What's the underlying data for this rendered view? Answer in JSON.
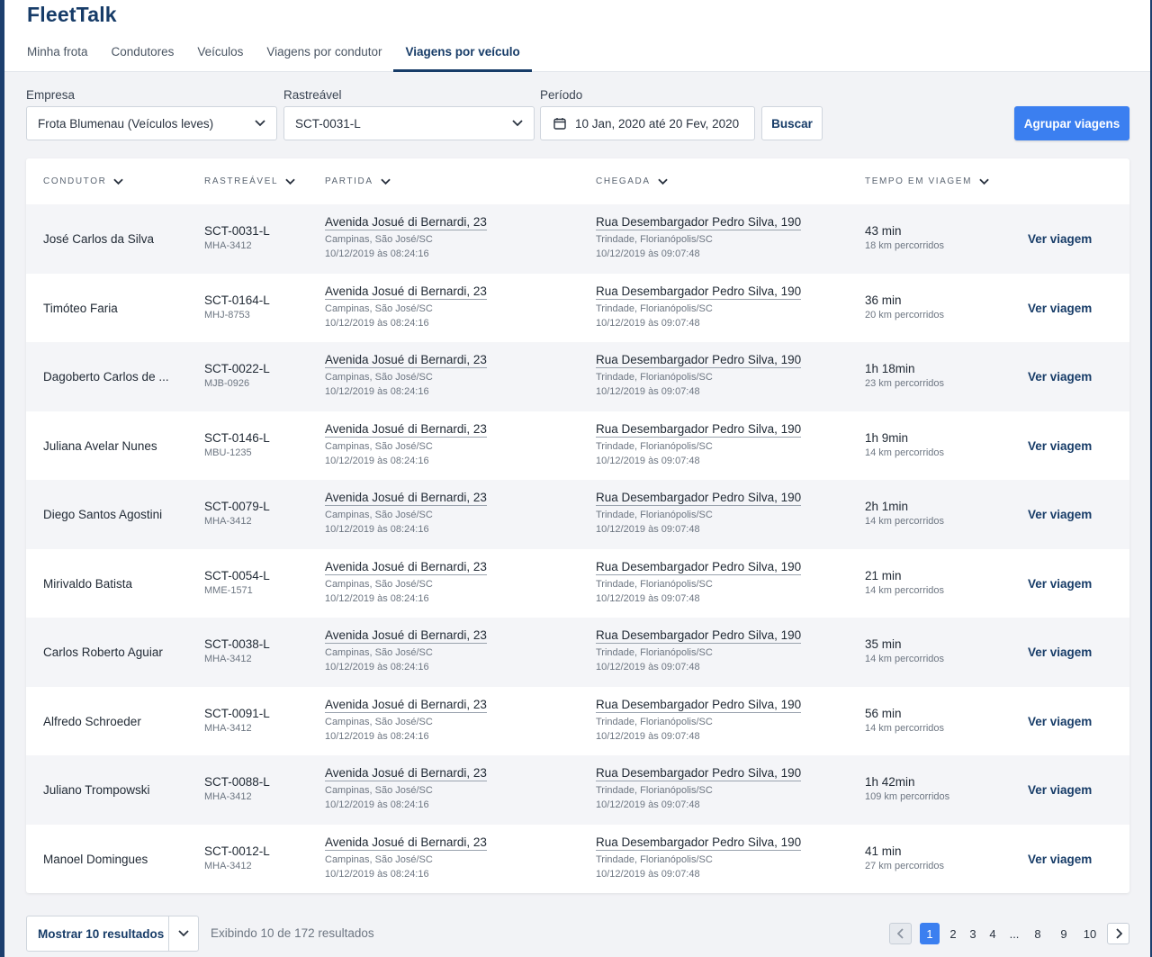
{
  "app": {
    "name": "FleetTalk"
  },
  "tabs": [
    {
      "label": "Minha frota"
    },
    {
      "label": "Condutores"
    },
    {
      "label": "Veículos"
    },
    {
      "label": "Viagens por condutor"
    },
    {
      "label": "Viagens por veículo",
      "active": true
    }
  ],
  "filters": {
    "company_label": "Empresa",
    "company_value": "Frota Blumenau (Veículos leves)",
    "tracker_label": "Rastreável",
    "tracker_value": "SCT-0031-L",
    "period_label": "Período",
    "period_value": "10 Jan, 2020 até 20 Fev, 2020",
    "search_button": "Buscar",
    "group_button": "Agrupar viagens"
  },
  "table": {
    "headers": {
      "driver": "CONDUTOR",
      "tracker": "RASTREÁVEL",
      "departure": "PARTIDA",
      "arrival": "CHEGADA",
      "duration": "TEMPO EM VIAGEM"
    },
    "action_label": "Ver viagem",
    "rows": [
      {
        "driver": "José Carlos da Silva",
        "tracker": "SCT-0031-L",
        "plate": "MHA-3412",
        "dep_addr": "Avenida Josué di Bernardi, 23",
        "dep_city": "Campinas, São José/SC",
        "dep_dt": "10/12/2019 às 08:24:16",
        "arr_addr": "Rua Desembargador Pedro Silva, 190",
        "arr_city": "Trindade, Florianópolis/SC",
        "arr_dt": "10/12/2019 às 09:07:48",
        "time": "43 min",
        "dist": "18 km percorridos"
      },
      {
        "driver": "Timóteo Faria",
        "tracker": "SCT-0164-L",
        "plate": "MHJ-8753",
        "dep_addr": "Avenida Josué di Bernardi, 23",
        "dep_city": "Campinas, São José/SC",
        "dep_dt": "10/12/2019 às 08:24:16",
        "arr_addr": "Rua Desembargador Pedro Silva, 190",
        "arr_city": "Trindade, Florianópolis/SC",
        "arr_dt": "10/12/2019 às 09:07:48",
        "time": "36 min",
        "dist": "20 km percorridos"
      },
      {
        "driver": "Dagoberto Carlos de ...",
        "tracker": "SCT-0022-L",
        "plate": "MJB-0926",
        "dep_addr": "Avenida Josué di Bernardi, 23",
        "dep_city": "Campinas, São José/SC",
        "dep_dt": "10/12/2019 às 08:24:16",
        "arr_addr": "Rua Desembargador Pedro Silva, 190",
        "arr_city": "Trindade, Florianópolis/SC",
        "arr_dt": "10/12/2019 às 09:07:48",
        "time": "1h 18min",
        "dist": "23 km percorridos"
      },
      {
        "driver": "Juliana Avelar Nunes",
        "tracker": "SCT-0146-L",
        "plate": "MBU-1235",
        "dep_addr": "Avenida Josué di Bernardi, 23",
        "dep_city": "Campinas, São José/SC",
        "dep_dt": "10/12/2019 às 08:24:16",
        "arr_addr": "Rua Desembargador Pedro Silva, 190",
        "arr_city": "Trindade, Florianópolis/SC",
        "arr_dt": "10/12/2019 às 09:07:48",
        "time": "1h 9min",
        "dist": "14 km percorridos"
      },
      {
        "driver": "Diego Santos Agostini",
        "tracker": "SCT-0079-L",
        "plate": "MHA-3412",
        "dep_addr": "Avenida Josué di Bernardi, 23",
        "dep_city": "Campinas, São José/SC",
        "dep_dt": "10/12/2019 às 08:24:16",
        "arr_addr": "Rua Desembargador Pedro Silva, 190",
        "arr_city": "Trindade, Florianópolis/SC",
        "arr_dt": "10/12/2019 às 09:07:48",
        "time": "2h 1min",
        "dist": "14 km percorridos"
      },
      {
        "driver": "Mirivaldo Batista",
        "tracker": "SCT-0054-L",
        "plate": "MME-1571",
        "dep_addr": "Avenida Josué di Bernardi, 23",
        "dep_city": "Campinas, São José/SC",
        "dep_dt": "10/12/2019 às 08:24:16",
        "arr_addr": "Rua Desembargador Pedro Silva, 190",
        "arr_city": "Trindade, Florianópolis/SC",
        "arr_dt": "10/12/2019 às 09:07:48",
        "time": "21 min",
        "dist": "14 km percorridos"
      },
      {
        "driver": "Carlos Roberto Aguiar",
        "tracker": "SCT-0038-L",
        "plate": "MHA-3412",
        "dep_addr": "Avenida Josué di Bernardi, 23",
        "dep_city": "Campinas, São José/SC",
        "dep_dt": "10/12/2019 às 08:24:16",
        "arr_addr": "Rua Desembargador Pedro Silva, 190",
        "arr_city": "Trindade, Florianópolis/SC",
        "arr_dt": "10/12/2019 às 09:07:48",
        "time": "35 min",
        "dist": "14 km percorridos"
      },
      {
        "driver": "Alfredo Schroeder",
        "tracker": "SCT-0091-L",
        "plate": "MHA-3412",
        "dep_addr": "Avenida Josué di Bernardi, 23",
        "dep_city": "Campinas, São José/SC",
        "dep_dt": "10/12/2019 às 08:24:16",
        "arr_addr": "Rua Desembargador Pedro Silva, 190",
        "arr_city": "Trindade, Florianópolis/SC",
        "arr_dt": "10/12/2019 às 09:07:48",
        "time": "56 min",
        "dist": "14 km percorridos"
      },
      {
        "driver": "Juliano Trompowski",
        "tracker": "SCT-0088-L",
        "plate": "MHA-3412",
        "dep_addr": "Avenida Josué di Bernardi, 23",
        "dep_city": "Campinas, São José/SC",
        "dep_dt": "10/12/2019 às 08:24:16",
        "arr_addr": "Rua Desembargador Pedro Silva, 190",
        "arr_city": "Trindade, Florianópolis/SC",
        "arr_dt": "10/12/2019 às 09:07:48",
        "time": "1h 42min",
        "dist": "109 km percorridos"
      },
      {
        "driver": "Manoel Domingues",
        "tracker": "SCT-0012-L",
        "plate": "MHA-3412",
        "dep_addr": "Avenida Josué di Bernardi, 23",
        "dep_city": "Campinas, São José/SC",
        "dep_dt": "10/12/2019 às 08:24:16",
        "arr_addr": "Rua Desembargador Pedro Silva, 190",
        "arr_city": "Trindade, Florianópolis/SC",
        "arr_dt": "10/12/2019 às 09:07:48",
        "time": "41 min",
        "dist": "27 km percorridos"
      }
    ]
  },
  "footer": {
    "show_label": "Mostrar 10 resultados",
    "results_text": "Exibindo 10 de 172 resultados",
    "pages": [
      "1",
      "2",
      "3",
      "4",
      "...",
      "8",
      "9",
      "10"
    ],
    "current_page": "1"
  },
  "colors": {
    "brand": "#173c68",
    "primary": "#3b7ff0",
    "row_alt": "#f4f5f8",
    "background": "#f2f3f6"
  }
}
